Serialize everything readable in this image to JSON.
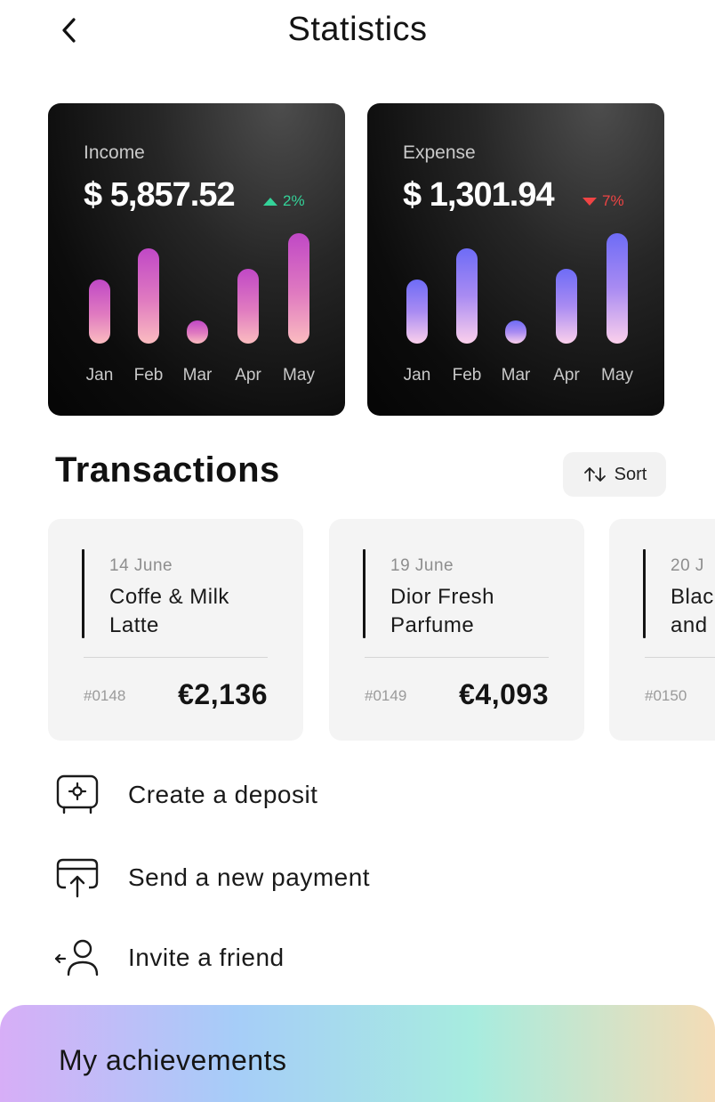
{
  "header": {
    "title": "Statistics",
    "back_icon": "chevron-left-icon"
  },
  "income": {
    "label": "Income",
    "amount": "$ 5,857.52",
    "change": "2%",
    "trend": "up",
    "months": [
      "Jan",
      "Feb",
      "Mar",
      "Apr",
      "May"
    ]
  },
  "expense": {
    "label": "Expense",
    "amount": "$ 1,301.94",
    "change": "7%",
    "trend": "down",
    "months": [
      "Jan",
      "Feb",
      "Mar",
      "Apr",
      "May"
    ]
  },
  "transactions": {
    "title": "Transactions",
    "sort_label": "Sort",
    "sort_icon": "sort-arrows-icon",
    "items": [
      {
        "date": "14 June",
        "title_line1": "Coffe & Milk",
        "title_line2": "Latte",
        "id": "#0148",
        "amount": "€2,136"
      },
      {
        "date": "19 June",
        "title_line1": "Dior Fresh",
        "title_line2": "Parfume",
        "id": "#0149",
        "amount": "€4,093"
      },
      {
        "date": "20 J",
        "title_line1": "Blac",
        "title_line2": "and",
        "id": "#0150",
        "amount": ""
      }
    ]
  },
  "actions": [
    {
      "label": "Create a deposit",
      "icon": "safe-icon"
    },
    {
      "label": "Send a new payment",
      "icon": "card-upload-icon"
    },
    {
      "label": "Invite a friend",
      "icon": "invite-user-icon"
    }
  ],
  "achievements": {
    "label": "My achievements"
  },
  "colors": {
    "positive": "#34d399",
    "negative": "#ef4444"
  }
}
